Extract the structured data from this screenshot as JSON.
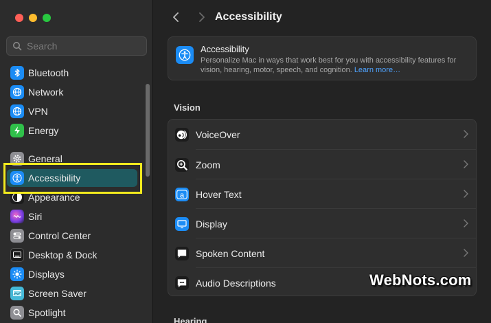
{
  "sidebar": {
    "search": {
      "placeholder": "Search",
      "value": ""
    },
    "items": [
      {
        "label": "Bluetooth",
        "icon": "bluetooth-icon",
        "color": "#1b8cf5"
      },
      {
        "label": "Network",
        "icon": "globe-icon",
        "color": "#1b8cf5"
      },
      {
        "label": "VPN",
        "icon": "globe-icon",
        "color": "#1b8cf5"
      },
      {
        "label": "Energy",
        "icon": "bolt-icon",
        "color": "#30c04a"
      },
      {
        "label": "General",
        "icon": "gear-icon",
        "color": "#8e8e93"
      },
      {
        "label": "Accessibility",
        "icon": "accessibility-icon",
        "color": "#1b8cf5",
        "selected": true
      },
      {
        "label": "Appearance",
        "icon": "appearance-icon",
        "color": "#1c1c1c"
      },
      {
        "label": "Siri",
        "icon": "siri-icon",
        "color": "#a144d8"
      },
      {
        "label": "Control Center",
        "icon": "toggles-icon",
        "color": "#8e8e93"
      },
      {
        "label": "Desktop & Dock",
        "icon": "dock-icon",
        "color": "#1c1c1c"
      },
      {
        "label": "Displays",
        "icon": "sun-icon",
        "color": "#1b8cf5"
      },
      {
        "label": "Screen Saver",
        "icon": "screensaver-icon",
        "color": "#45b9d8"
      },
      {
        "label": "Spotlight",
        "icon": "magnifier-icon",
        "color": "#8e8e93"
      }
    ]
  },
  "main": {
    "title": "Accessibility",
    "header": {
      "title": "Accessibility",
      "description": "Personalize Mac in ways that work best for you with accessibility features for vision, hearing, motor, speech, and cognition.",
      "link": "Learn more…"
    },
    "sections": [
      {
        "title": "Vision",
        "rows": [
          {
            "label": "VoiceOver",
            "icon": "voiceover-icon"
          },
          {
            "label": "Zoom",
            "icon": "zoom-icon"
          },
          {
            "label": "Hover Text",
            "icon": "hover-text-icon"
          },
          {
            "label": "Display",
            "icon": "display-icon"
          },
          {
            "label": "Spoken Content",
            "icon": "speech-bubble-icon"
          },
          {
            "label": "Audio Descriptions",
            "icon": "audio-description-icon"
          }
        ]
      },
      {
        "title": "Hearing"
      }
    ]
  },
  "watermark": {
    "text": "WebNots.com"
  },
  "colors": {
    "accent": "#1b8cf5",
    "selection": "#1f5a60",
    "highlight_box": "#f2ea1e",
    "link": "#4fa3ff"
  }
}
